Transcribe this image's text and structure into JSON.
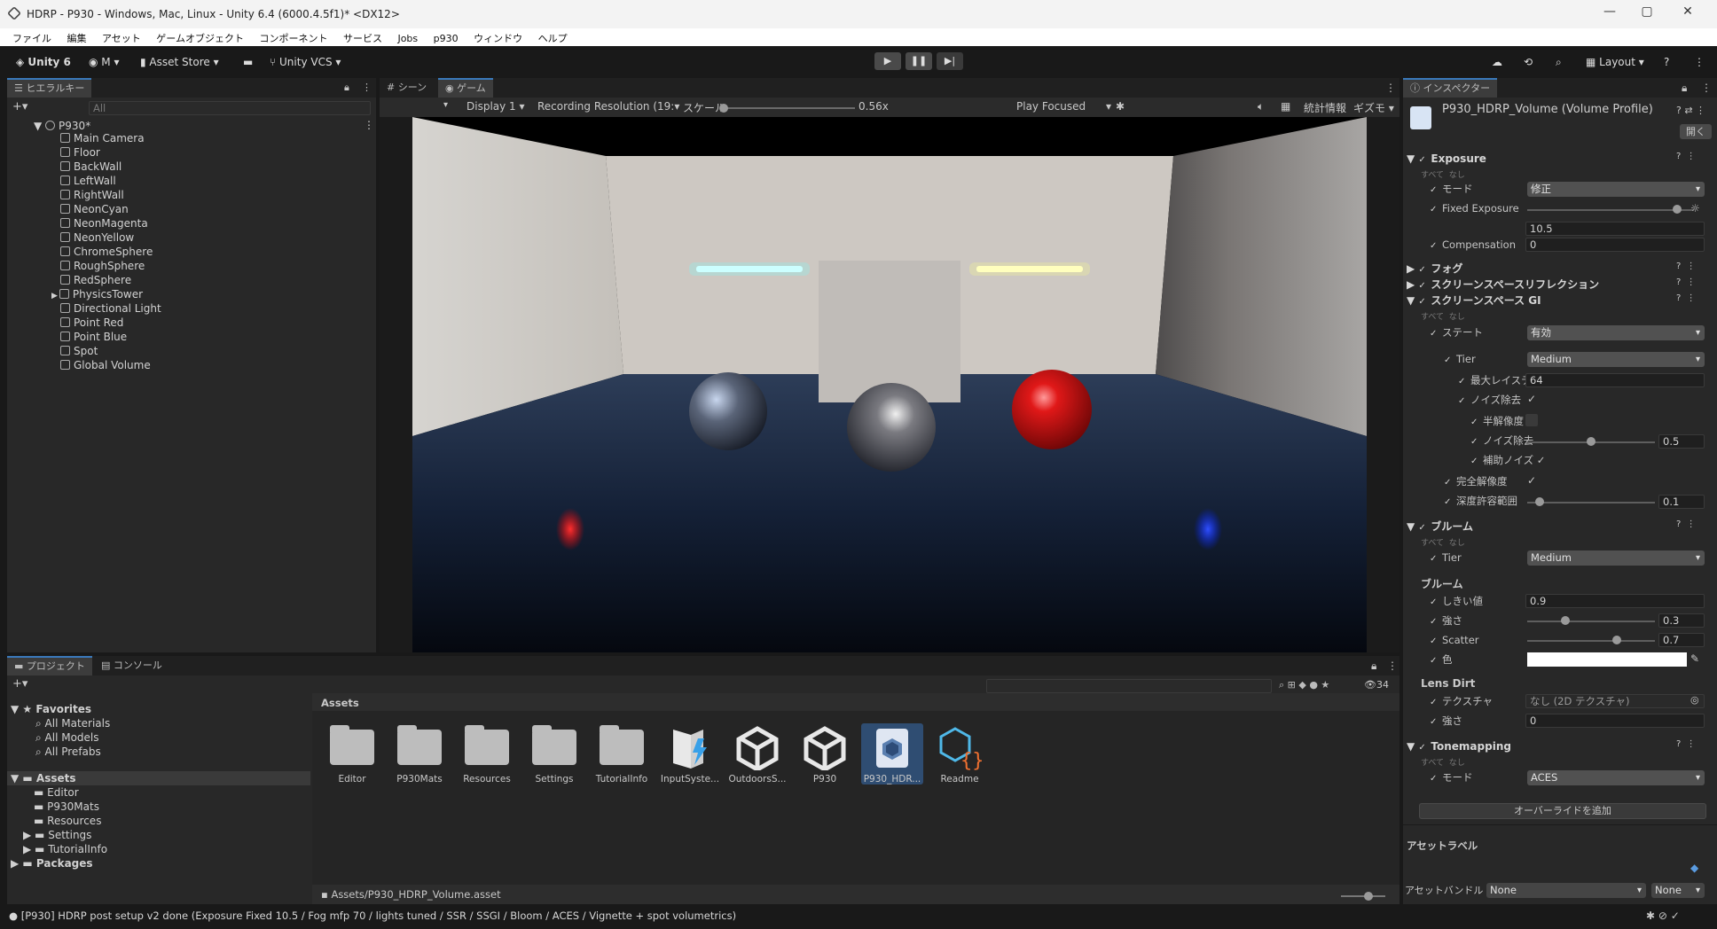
{
  "window": {
    "title": "HDRP - P930 - Windows, Mac, Linux - Unity 6.4 (6000.4.5f1)* <DX12>",
    "min": "—",
    "max": "▢",
    "close": "✕"
  },
  "menu": [
    "ファイル",
    "編集",
    "アセット",
    "ゲームオブジェクト",
    "コンポーネント",
    "サービス",
    "Jobs",
    "p930",
    "ウィンドウ",
    "ヘルプ"
  ],
  "toolbar": {
    "unity": "Unity 6",
    "account": "M",
    "asset_store": "Asset Store",
    "vcs": "Unity VCS",
    "layout": "Layout",
    "play": "▶",
    "pause": "❚❚",
    "step": "▶|"
  },
  "hierarchy": {
    "tab": "ヒエラルキー",
    "search_placeholder": "All",
    "scene": "P930*",
    "items": [
      "Main Camera",
      "Floor",
      "BackWall",
      "LeftWall",
      "RightWall",
      "NeonCyan",
      "NeonMagenta",
      "NeonYellow",
      "ChromeSphere",
      "RoughSphere",
      "RedSphere",
      "PhysicsTower",
      "Directional Light",
      "Point Red",
      "Point Blue",
      "Spot",
      "Global Volume"
    ]
  },
  "game": {
    "tab_scene": "シーン",
    "tab_game": "ゲーム",
    "display": "Display 1",
    "resolution": "Recording Resolution (19:",
    "scale_label": "スケール",
    "scale_value": "0.56x",
    "play_focused": "Play Focused",
    "stats": "統計情報",
    "gizmos": "ギズモ"
  },
  "project": {
    "tab_project": "プロジェクト",
    "tab_console": "コンソール",
    "count": "34",
    "favorites": "Favorites",
    "fav_items": [
      "All Materials",
      "All Models",
      "All Prefabs"
    ],
    "assets": "Assets",
    "asset_folders": [
      "Editor",
      "P930Mats",
      "Resources",
      "Settings",
      "TutorialInfo"
    ],
    "packages": "Packages",
    "breadcrumb": "Assets",
    "grid": [
      "Editor",
      "P930Mats",
      "Resources",
      "Settings",
      "TutorialInfo",
      "InputSyste...",
      "OutdoorsS...",
      "P930",
      "P930_HDR...",
      "Readme"
    ],
    "path": "Assets/P930_HDRP_Volume.asset"
  },
  "inspector": {
    "tab": "インスペクター",
    "title": "P930_HDRP_Volume (Volume Profile)",
    "open": "開く",
    "exposure": {
      "title": "Exposure",
      "all": "すべて",
      "none": "なし",
      "mode_label": "モード",
      "mode": "修正",
      "fixed_label": "Fixed Exposure",
      "fixed": "10.5",
      "comp_label": "Compensation",
      "comp": "0",
      "fixed_slider": 0.9
    },
    "fog": "フォグ",
    "ssr": "スクリーンスペースリフレクション",
    "ssgi": {
      "title": "スクリーンスペース GI",
      "all": "すべて",
      "none": "なし",
      "state_label": "ステート",
      "state": "有効",
      "tier_label": "Tier",
      "tier": "Medium",
      "max_ray_label": "最大レイステ",
      "max_ray": "64",
      "denoise_label": "ノイズ除去",
      "half_label": "半解像度",
      "denoise2_label": "ノイズ除去",
      "denoise2": "0.5",
      "denoise2_slider": 0.5,
      "aux_label": "補助ノイズ",
      "full_label": "完全解像度",
      "depth_label": "深度許容範囲",
      "depth": "0.1",
      "depth_slider": 0.1
    },
    "bloom": {
      "title": "ブルーム",
      "all": "すべて",
      "none": "なし",
      "tier_label": "Tier",
      "tier": "Medium",
      "section": "ブルーム",
      "threshold_label": "しきい値",
      "threshold": "0.9",
      "intensity_label": "強さ",
      "intensity": "0.3",
      "intensity_slider": 0.3,
      "scatter_label": "Scatter",
      "scatter": "0.7",
      "scatter_slider": 0.7,
      "color_label": "色",
      "lens_dirt": "Lens Dirt",
      "texture_label": "テクスチャ",
      "texture": "なし (2D テクスチャ)",
      "dirt_int_label": "強さ",
      "dirt_int": "0"
    },
    "tonemapping": {
      "title": "Tonemapping",
      "all": "すべて",
      "none": "なし",
      "mode_label": "モード",
      "mode": "ACES"
    },
    "add_override": "オーバーライドを追加",
    "asset_labels": "アセットラベル",
    "asset_bundle_label": "アセットバンドル",
    "bundle": "None",
    "variant": "None"
  },
  "status": "[P930] HDRP post setup v2 done (Exposure Fixed 10.5 / Fog mfp 70 / lights tuned / SSR / SSGI / Bloom / ACES / Vignette + spot volumetrics)"
}
